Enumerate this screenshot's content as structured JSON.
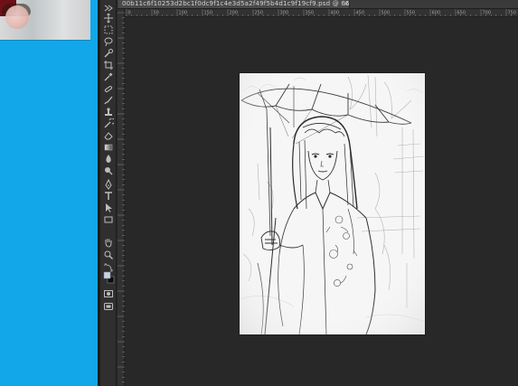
{
  "document": {
    "tab_title": "00b11c6f10253d2bc1f0dc9f1c4e3d5a2f49f5b4d1c9f19cf9.psd @ 66.7% (图层 1, RGB/8#)",
    "close_glyph": "×"
  },
  "ruler": {
    "top_labels": [
      "0",
      "50",
      "100",
      "150",
      "200",
      "250",
      "300",
      "350",
      "400",
      "450",
      "500",
      "550",
      "600",
      "650",
      "700",
      "750"
    ]
  },
  "toolbox": {
    "tools": [
      "expand-icon",
      "move-icon",
      "marquee-icon",
      "lasso-icon",
      "quick-select-icon",
      "crop-icon",
      "eyedropper-icon",
      "healing-icon",
      "brush-icon",
      "clone-stamp-icon",
      "history-brush-icon",
      "eraser-icon",
      "gradient-icon",
      "blur-icon",
      "dodge-icon",
      "pen-icon",
      "type-icon",
      "path-select-icon",
      "shape-icon",
      "hand-icon",
      "zoom-icon",
      "swap-colors-icon",
      "color-swatches-icon",
      "quick-mask-icon",
      "screen-mode-icon"
    ]
  },
  "colors": {
    "desktop": "#11a7e8",
    "workspace": "#282828",
    "panel": "#2f2f2f",
    "canvas": "#f7f7f7",
    "foreground": "#0d0d0d",
    "background": "#c5d3ea"
  }
}
